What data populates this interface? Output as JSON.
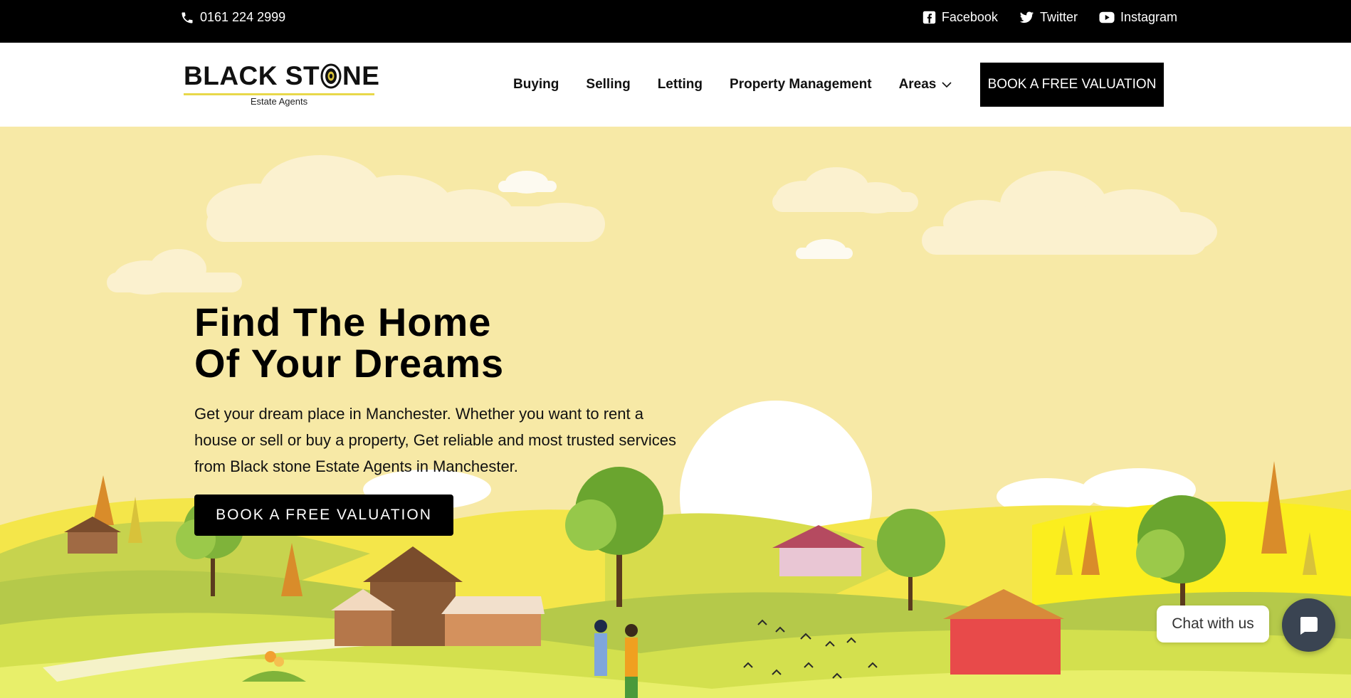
{
  "topbar": {
    "phone": "0161 224 2999",
    "social": [
      {
        "label": "Facebook",
        "icon": "facebook-icon"
      },
      {
        "label": "Twitter",
        "icon": "twitter-icon"
      },
      {
        "label": "Instagram",
        "icon": "youtube-icon"
      }
    ]
  },
  "header": {
    "logo": {
      "left": "BLACK ST",
      "right": "NE",
      "sub": "Estate Agents"
    },
    "nav": [
      {
        "label": "Buying"
      },
      {
        "label": "Selling"
      },
      {
        "label": "Letting"
      },
      {
        "label": "Property Management"
      },
      {
        "label": "Areas"
      }
    ],
    "cta_label": "BOOK A FREE VALUATION"
  },
  "hero": {
    "title_line1": "Find The Home",
    "title_line2": "Of Your Dreams",
    "text": "Get your dream place in Manchester. Whether you want to rent a house or sell or buy a property, Get reliable and most trusted services from Black stone Estate Agents in Manchester.",
    "cta_label": "BOOK A FREE VALUATION"
  },
  "chat": {
    "label": "Chat with us"
  },
  "colors": {
    "topbar_bg": "#000000",
    "hero_bg": "#f7e9a6",
    "hill_yellow": "#fbee1e",
    "hill_green": "#b5c94a",
    "chat_bubble": "#3a4452"
  }
}
